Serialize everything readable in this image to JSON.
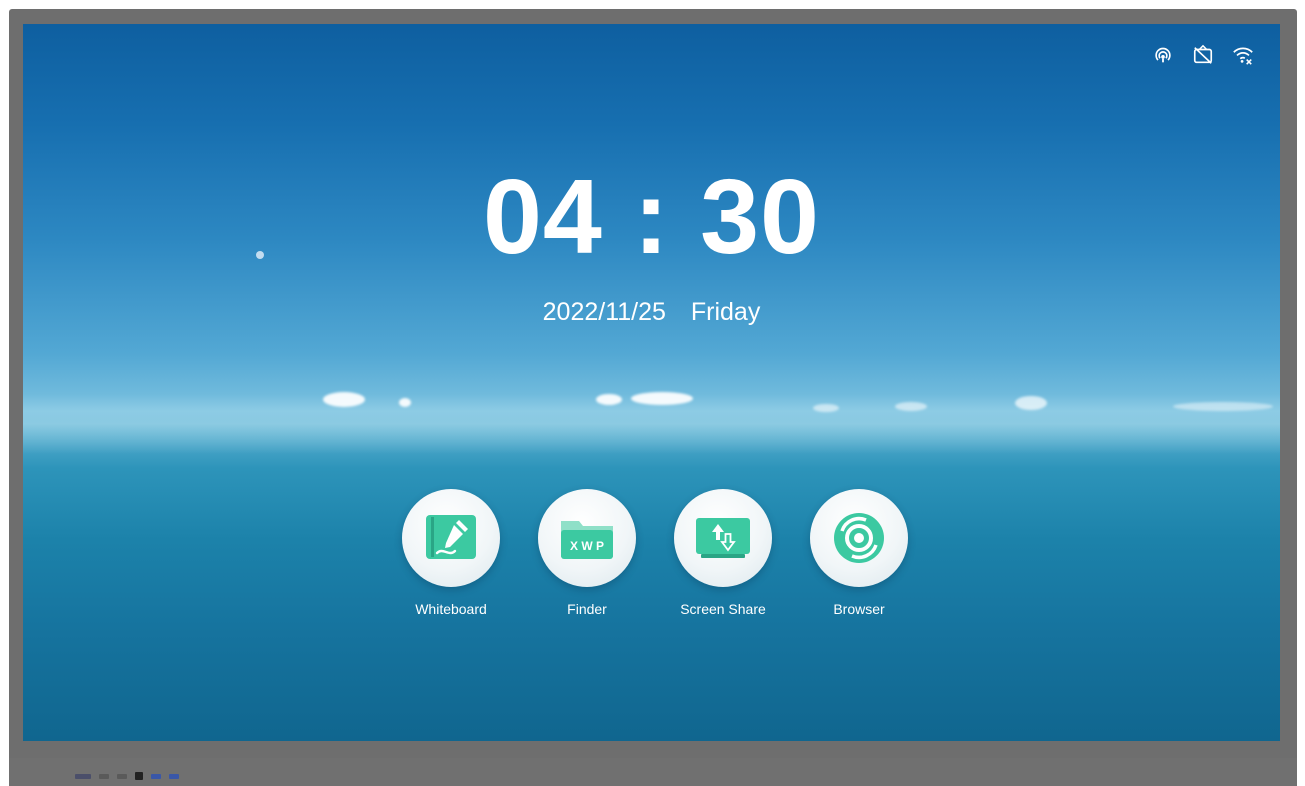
{
  "status_bar": {
    "icons": [
      "hotspot-icon",
      "no-signal-icon",
      "wifi-disconnected-icon"
    ]
  },
  "clock": {
    "time": "04 : 30",
    "date": "2022/11/25",
    "weekday": "Friday"
  },
  "apps": [
    {
      "label": "Whiteboard",
      "icon": "whiteboard-icon"
    },
    {
      "label": "Finder",
      "icon": "finder-icon",
      "icon_text": "X W P"
    },
    {
      "label": "Screen Share",
      "icon": "screen-share-icon"
    },
    {
      "label": "Browser",
      "icon": "browser-icon"
    }
  ],
  "colors": {
    "app_accent": "#3cc9a1",
    "app_accent_dark": "#2aa585"
  }
}
